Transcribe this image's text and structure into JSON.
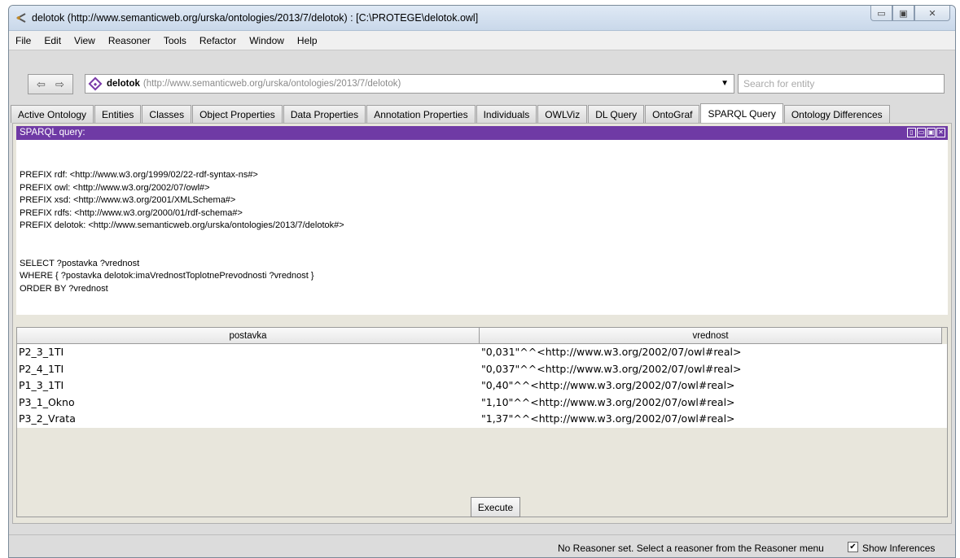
{
  "window": {
    "title": "delotok (http://www.semanticweb.org/urska/ontologies/2013/7/delotok)  : [C:\\PROTEGE\\delotok.owl]",
    "minimize_glyph": "▭",
    "maximize_glyph": "▣",
    "close_glyph": "✕"
  },
  "menu": [
    "File",
    "Edit",
    "View",
    "Reasoner",
    "Tools",
    "Refactor",
    "Window",
    "Help"
  ],
  "nav": {
    "back_glyph": "⇦",
    "forward_glyph": "⇨",
    "ontology_name": "delotok",
    "ontology_iri": "(http://www.semanticweb.org/urska/ontologies/2013/7/delotok)",
    "dropdown_glyph": "▼",
    "search_placeholder": "Search for entity"
  },
  "tabs": [
    "Active Ontology",
    "Entities",
    "Classes",
    "Object Properties",
    "Data Properties",
    "Annotation Properties",
    "Individuals",
    "OWLViz",
    "DL Query",
    "OntoGraf",
    "SPARQL Query",
    "Ontology Differences"
  ],
  "active_tab_index": 10,
  "view": {
    "title": "SPARQL query:",
    "ctrl_glyphs": [
      "▯",
      "▭",
      "▣",
      "✕"
    ]
  },
  "query": {
    "lines": [
      "PREFIX rdf: <http://www.w3.org/1999/02/22-rdf-syntax-ns#>",
      "PREFIX owl: <http://www.w3.org/2002/07/owl#>",
      "PREFIX xsd: <http://www.w3.org/2001/XMLSchema#>",
      "PREFIX rdfs: <http://www.w3.org/2000/01/rdf-schema#>",
      "PREFIX delotok: <http://www.semanticweb.org/urska/ontologies/2013/7/delotok#>",
      "",
      "",
      "SELECT ?postavka ?vrednost",
      "WHERE { ?postavka delotok:imaVrednostToplotnePrevodnosti ?vrednost }",
      "ORDER BY ?vrednost"
    ]
  },
  "results": {
    "columns": [
      "postavka",
      "vrednost"
    ],
    "rows": [
      [
        "P2_3_1TI",
        "\"0,031\"^^<http://www.w3.org/2002/07/owl#real>"
      ],
      [
        "P2_4_1TI",
        "\"0,037\"^^<http://www.w3.org/2002/07/owl#real>"
      ],
      [
        "P1_3_1TI",
        "\"0,40\"^^<http://www.w3.org/2002/07/owl#real>"
      ],
      [
        "P3_1_Okno",
        "\"1,10\"^^<http://www.w3.org/2002/07/owl#real>"
      ],
      [
        "P3_2_Vrata",
        "\"1,37\"^^<http://www.w3.org/2002/07/owl#real>"
      ]
    ]
  },
  "execute_label": "Execute",
  "status": {
    "reasoner_text": "No Reasoner set. Select a reasoner from the Reasoner menu",
    "show_inferences_label": "Show Inferences",
    "show_inferences_checked": true,
    "check_glyph": "✔"
  },
  "colors": {
    "view_header": "#6f3aa5",
    "ontology_icon": "#7a3aa8"
  }
}
